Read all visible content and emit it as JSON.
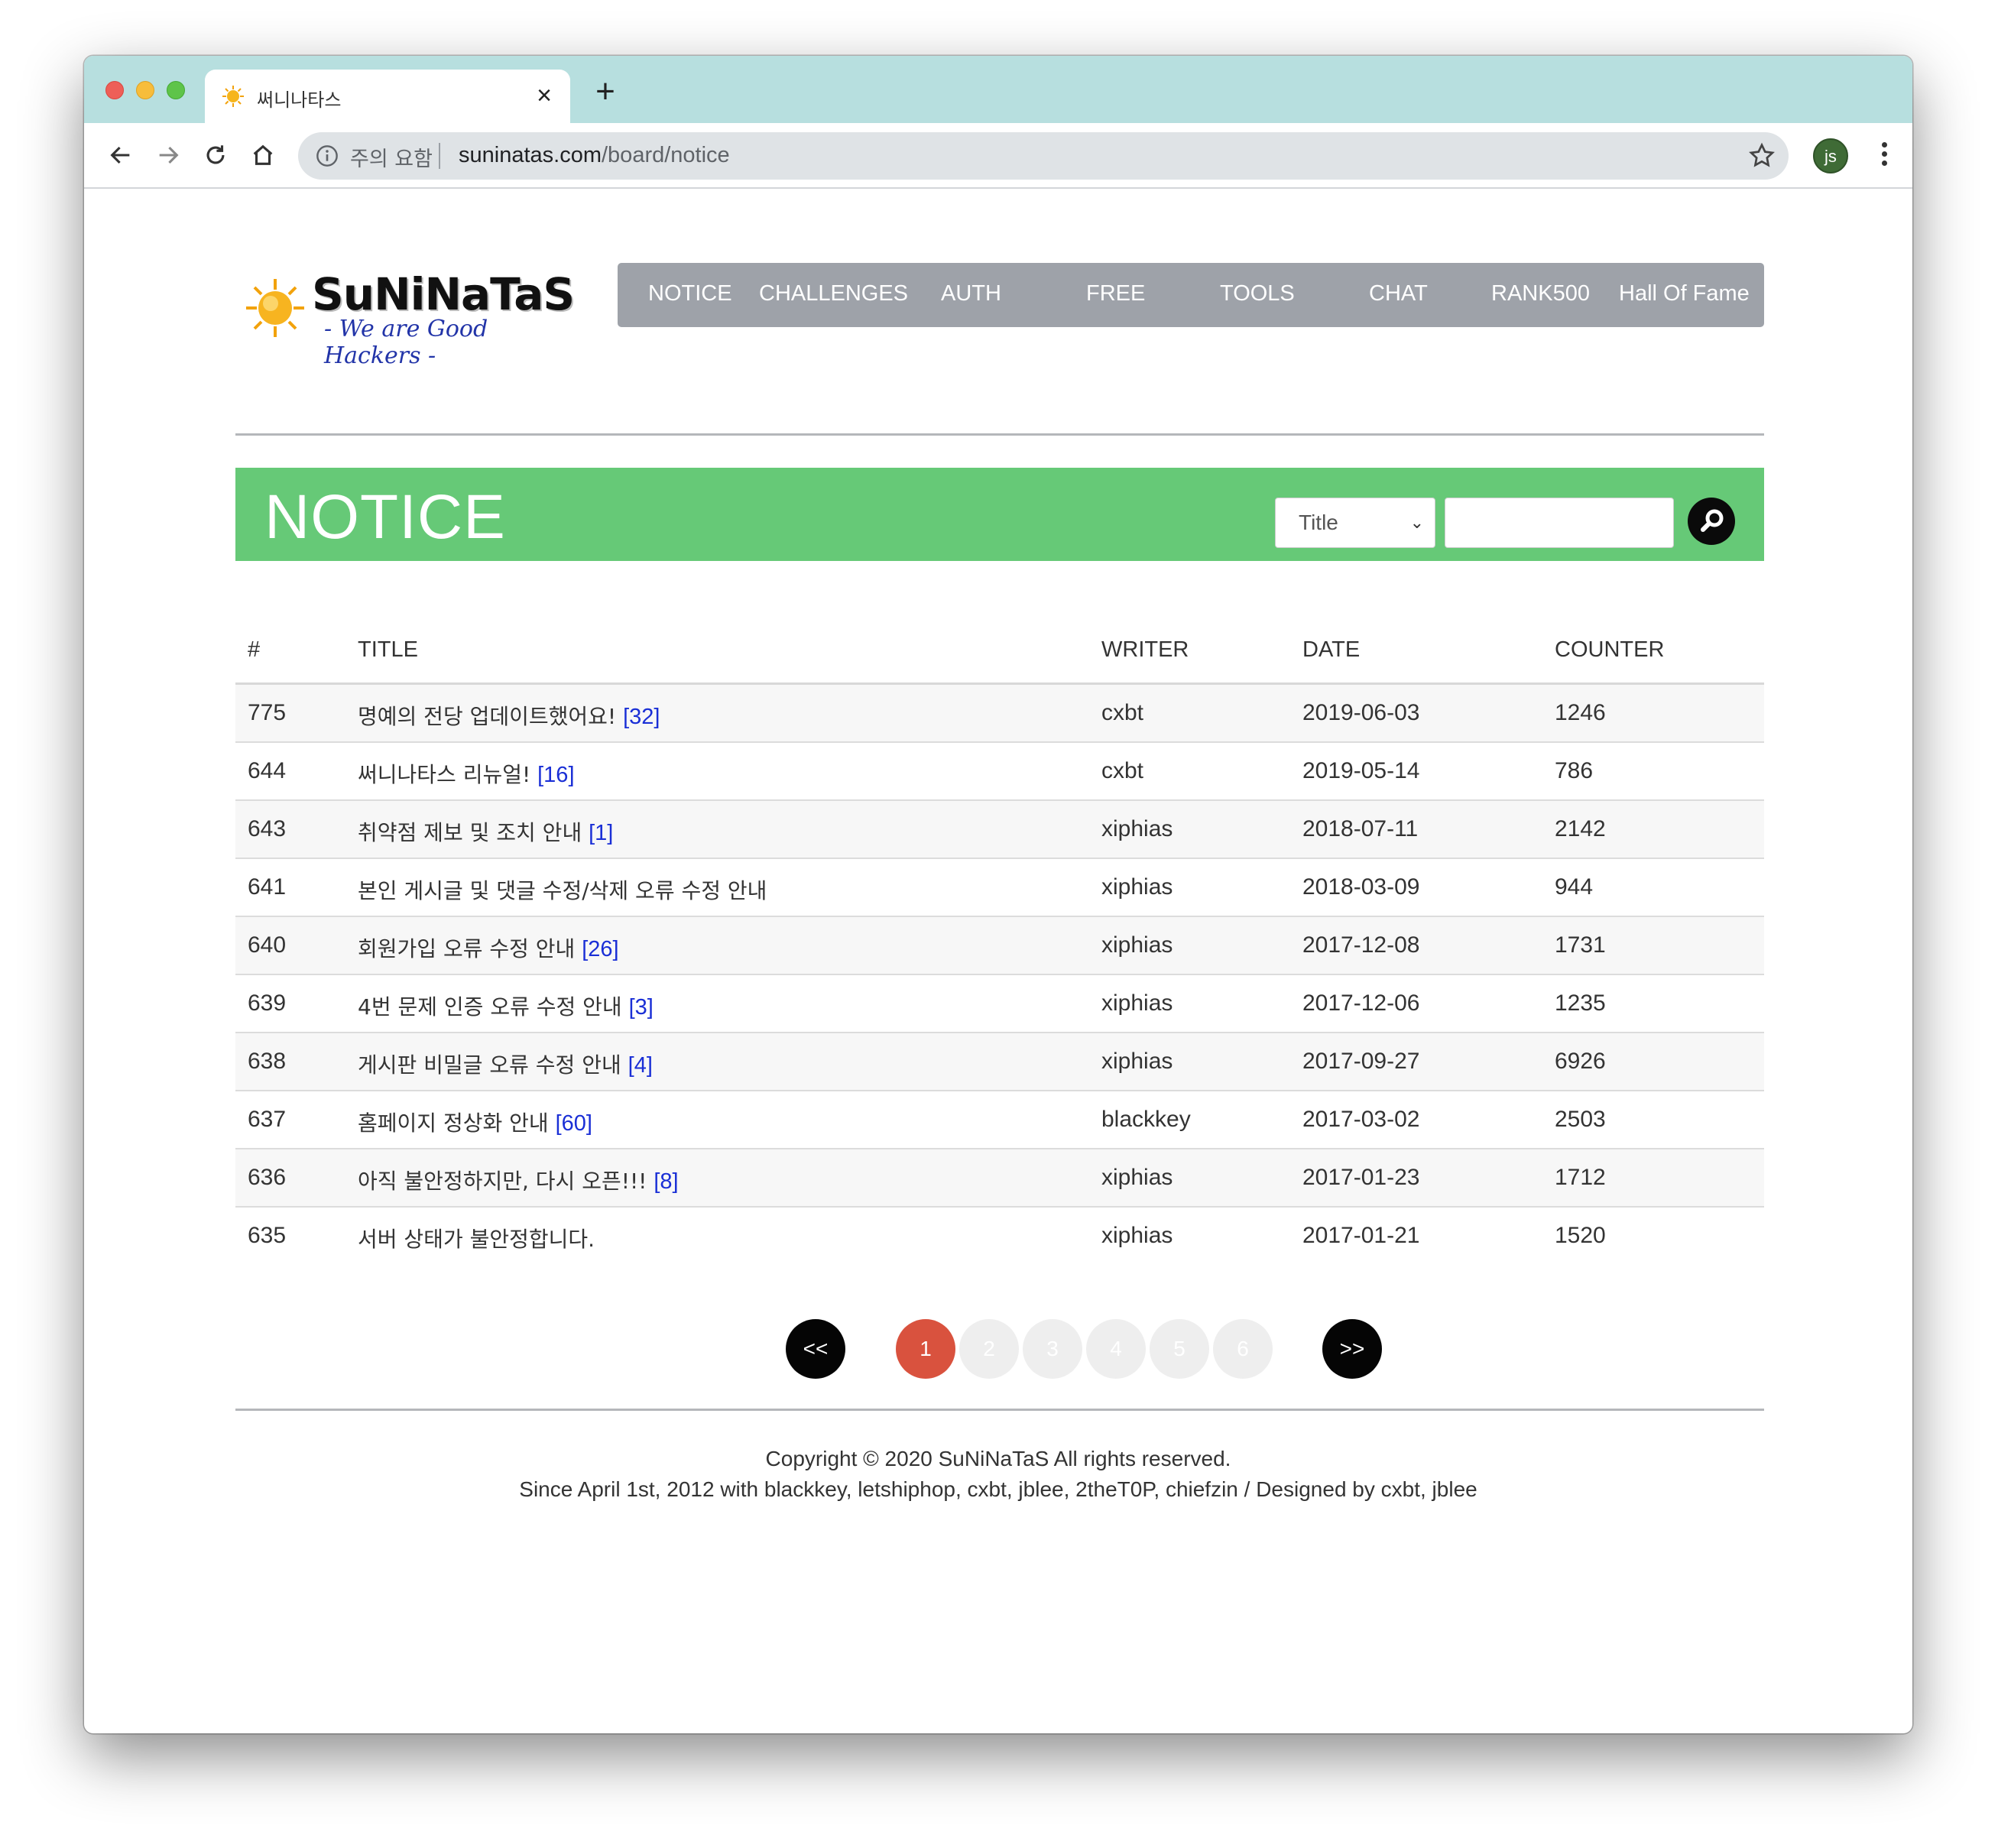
{
  "browser": {
    "tab_title": "써니나타스",
    "close_glyph": "×",
    "newtab_glyph": "+",
    "security_label": "주의 요함",
    "url_host": "suninatas.com",
    "url_path": "/board/notice",
    "profile_initials": "js"
  },
  "site": {
    "logo_title": "SuNiNaTaS",
    "logo_subtitle": "- We are Good Hackers -",
    "nav": [
      "NOTICE",
      "CHALLENGES",
      "AUTH",
      "FREE",
      "TOOLS",
      "CHAT",
      "RANK500",
      "Hall Of Fame"
    ]
  },
  "board": {
    "heading": "NOTICE",
    "search_field_selected": "Title",
    "search_value": "",
    "columns": {
      "num": "#",
      "title": "TITLE",
      "writer": "WRITER",
      "date": "DATE",
      "counter": "COUNTER"
    },
    "rows": [
      {
        "num": "775",
        "title": "명예의 전당 업데이트했어요!",
        "comments": "[32]",
        "writer": "cxbt",
        "date": "2019-06-03",
        "counter": "1246"
      },
      {
        "num": "644",
        "title": "써니나타스 리뉴얼!",
        "comments": "[16]",
        "writer": "cxbt",
        "date": "2019-05-14",
        "counter": "786"
      },
      {
        "num": "643",
        "title": "취약점 제보 및 조치 안내",
        "comments": "[1]",
        "writer": "xiphias",
        "date": "2018-07-11",
        "counter": "2142"
      },
      {
        "num": "641",
        "title": "본인 게시글 및 댓글 수정/삭제 오류 수정 안내",
        "comments": "",
        "writer": "xiphias",
        "date": "2018-03-09",
        "counter": "944"
      },
      {
        "num": "640",
        "title": "회원가입 오류 수정 안내",
        "comments": "[26]",
        "writer": "xiphias",
        "date": "2017-12-08",
        "counter": "1731"
      },
      {
        "num": "639",
        "title": "4번 문제 인증 오류 수정 안내",
        "comments": "[3]",
        "writer": "xiphias",
        "date": "2017-12-06",
        "counter": "1235"
      },
      {
        "num": "638",
        "title": "게시판 비밀글 오류 수정 안내",
        "comments": "[4]",
        "writer": "xiphias",
        "date": "2017-09-27",
        "counter": "6926"
      },
      {
        "num": "637",
        "title": "홈페이지 정상화 안내",
        "comments": "[60]",
        "writer": "blackkey",
        "date": "2017-03-02",
        "counter": "2503"
      },
      {
        "num": "636",
        "title": "아직 불안정하지만, 다시 오픈!!!",
        "comments": "[8]",
        "writer": "xiphias",
        "date": "2017-01-23",
        "counter": "1712"
      },
      {
        "num": "635",
        "title": "서버 상태가 불안정합니다.",
        "comments": "",
        "writer": "xiphias",
        "date": "2017-01-21",
        "counter": "1520"
      }
    ]
  },
  "pagination": {
    "prev": "<<",
    "next": ">>",
    "pages": [
      "1",
      "2",
      "3",
      "4",
      "5",
      "6"
    ],
    "current": "1"
  },
  "footer": {
    "line1": "Copyright © 2020 SuNiNaTaS All rights reserved.",
    "line2": "Since April 1st, 2012 with blackkey, letshiphop, cxbt, jblee, 2theT0P, chiefzin / Designed by cxbt, jblee"
  },
  "colors": {
    "banner": "#66c977",
    "nav_bg": "#9ea2a9",
    "active_page": "#d9523e",
    "comment_link": "#1a2fd6"
  }
}
